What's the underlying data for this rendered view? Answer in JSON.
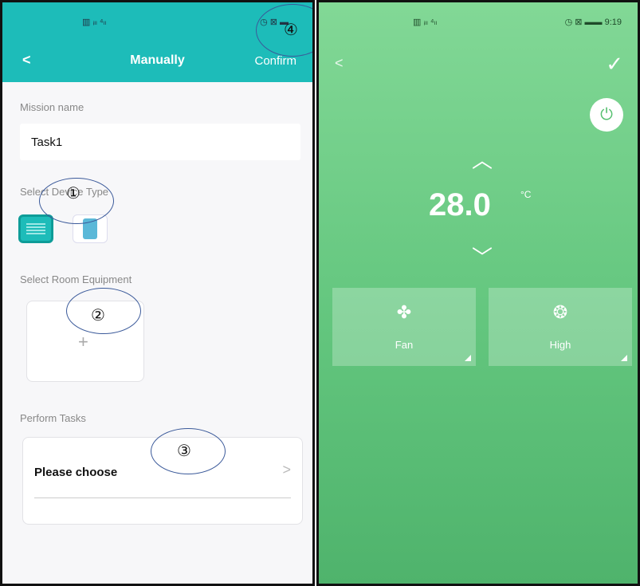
{
  "left": {
    "status": {
      "signal": "▥ ᵢₗₗ ⁴ₗₗ",
      "icons": "◷ ⊠ ▬"
    },
    "header": {
      "back": "<",
      "title": "Manually",
      "confirm": "Confirm"
    },
    "mission": {
      "label": "Mission name",
      "value": "Task1"
    },
    "device_type": {
      "label": "Select Device Type",
      "selected": "air-conditioner"
    },
    "room_equipment": {
      "label": "Select Room Equipment",
      "add_symbol": "+"
    },
    "tasks": {
      "label": "Perform Tasks",
      "value": "Please choose",
      "chevron": ">"
    },
    "callouts": [
      "①",
      "②",
      "③",
      "④"
    ]
  },
  "right": {
    "status": {
      "signal": "▥ ᵢₗₗ ⁴ₗₗ",
      "icons": "◷ ⊠ ▬▬ 9:19"
    },
    "back": "<",
    "check": "✓",
    "power_icon": "⏻",
    "temp_up": "︿",
    "temperature": "28.0",
    "unit": "°C",
    "temp_down": "﹀",
    "tiles": [
      {
        "icon": "✤",
        "label": "Fan"
      },
      {
        "icon": "❂",
        "label": "High"
      }
    ]
  },
  "colors": {
    "teal": "#1dbcb9",
    "green": "#63c67e"
  }
}
